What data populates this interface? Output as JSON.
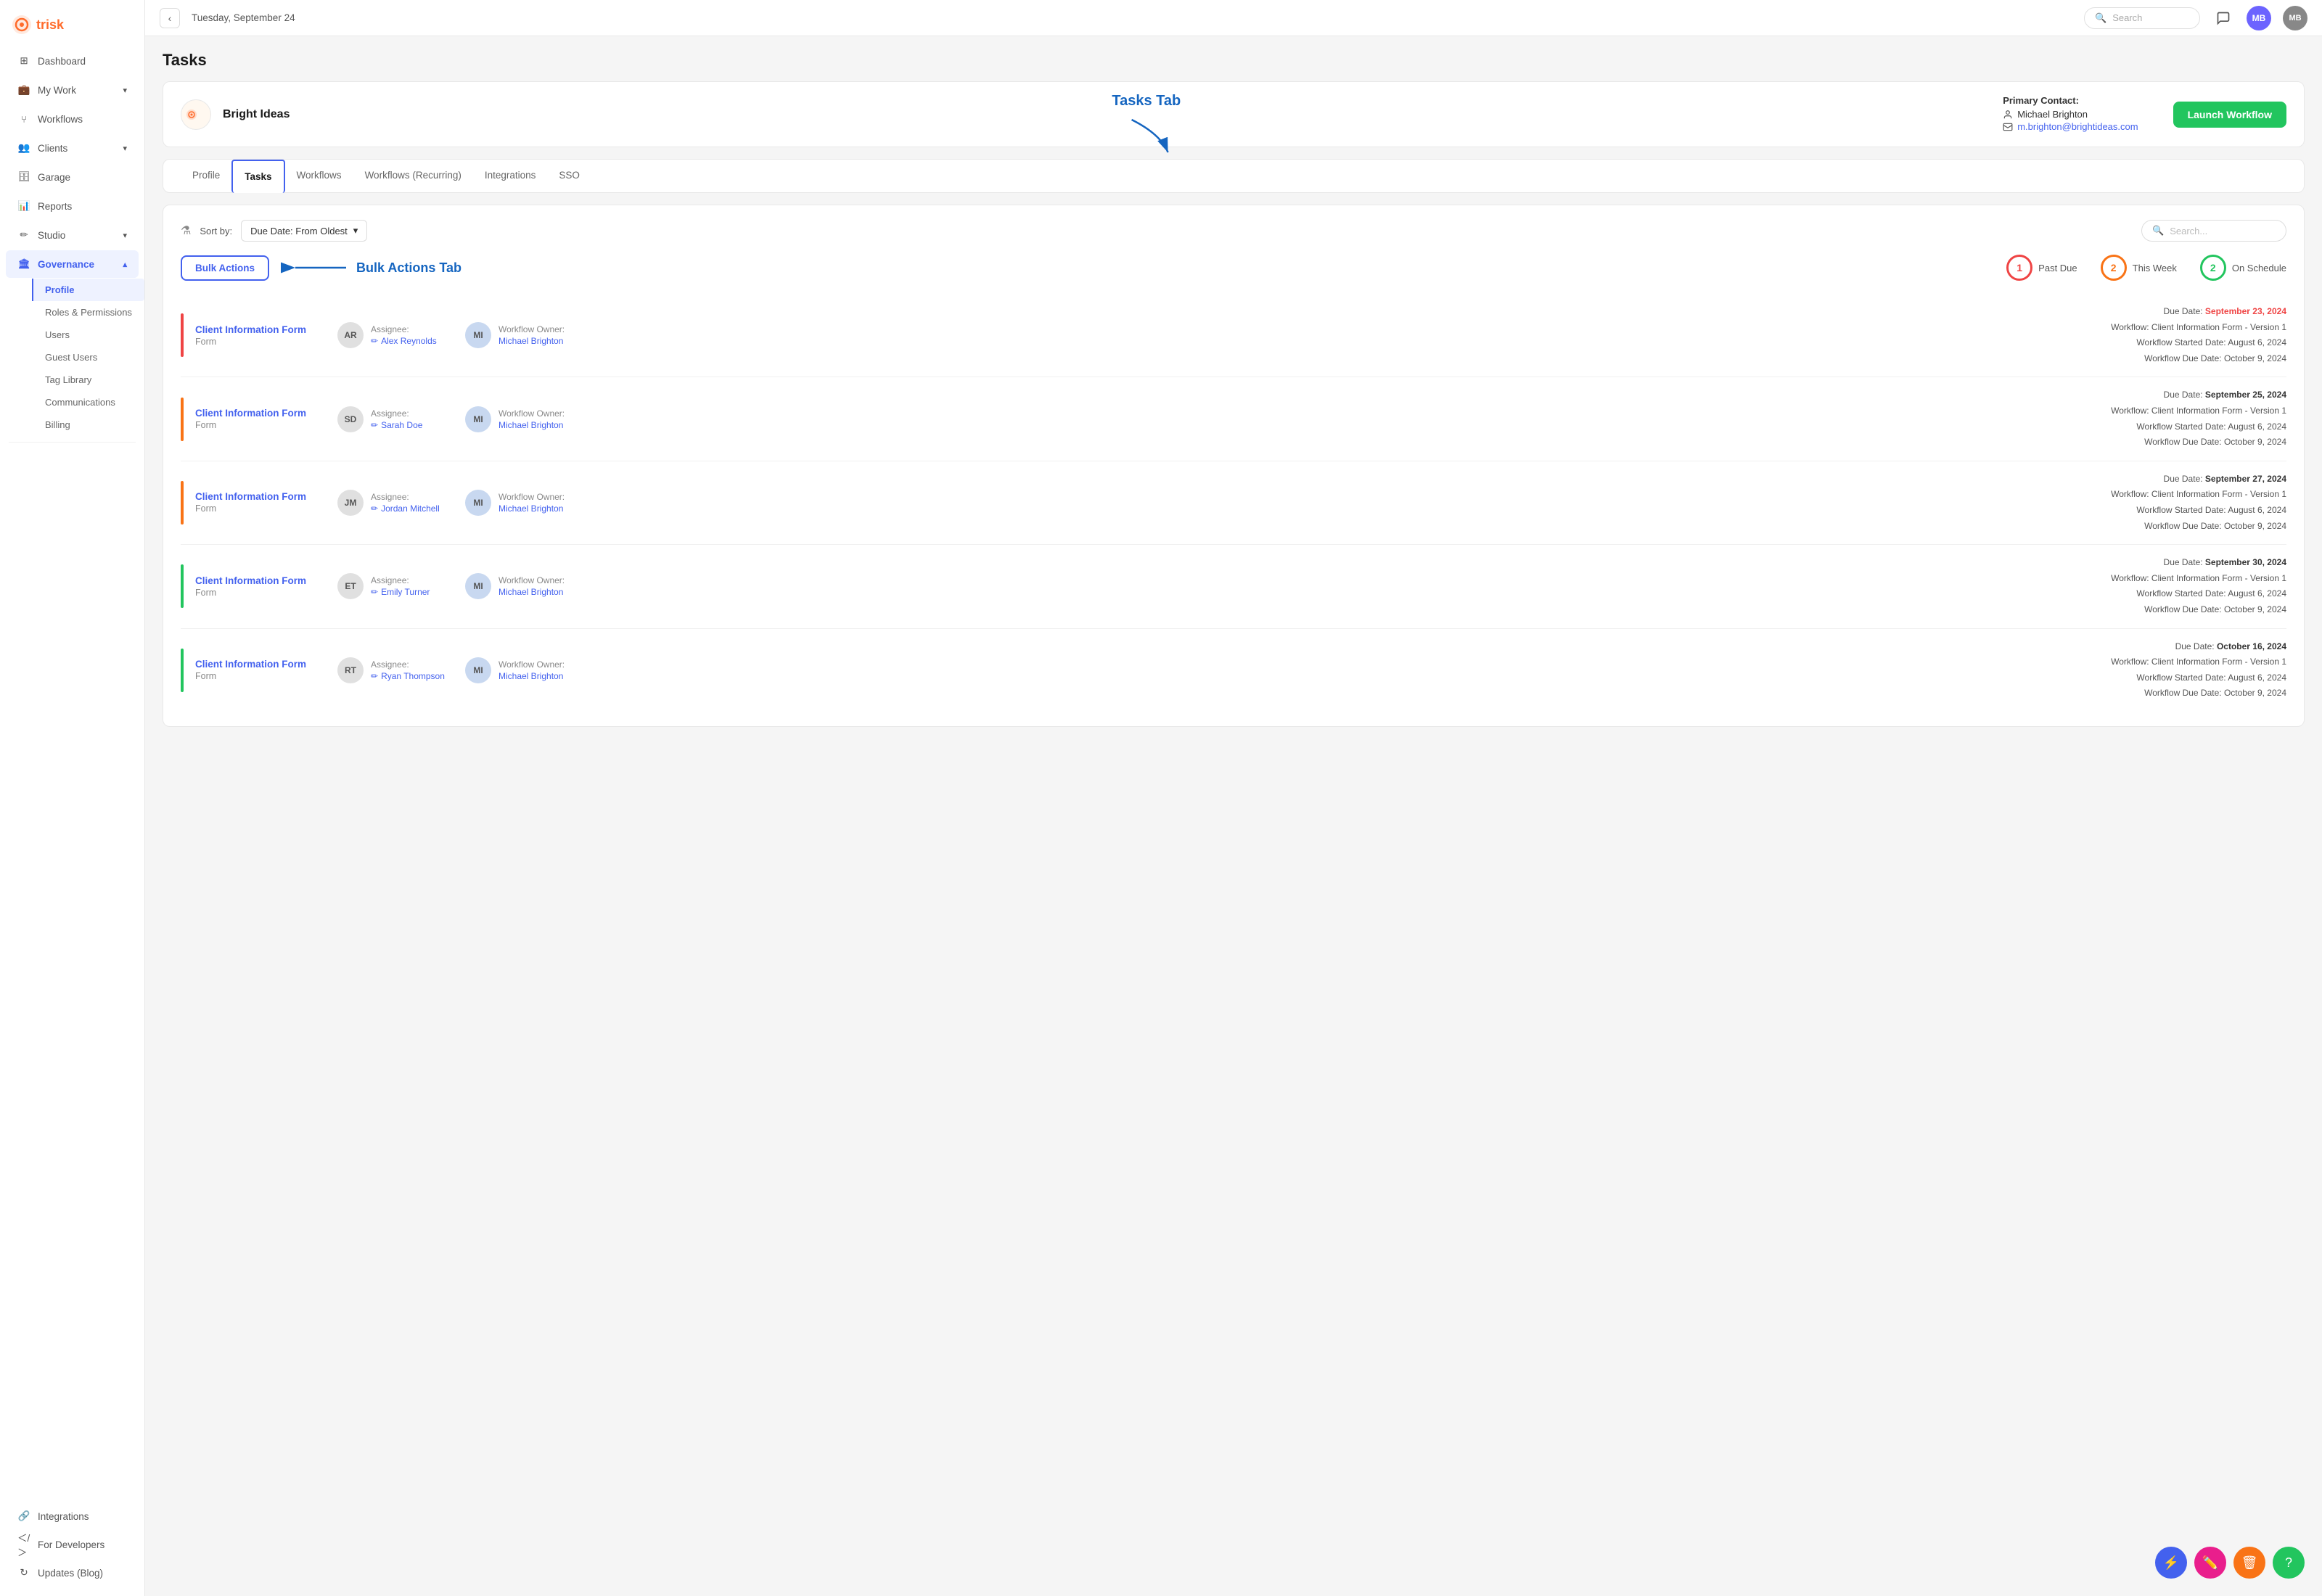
{
  "app": {
    "logo_text": "trisk",
    "header_date": "Tuesday, September 24",
    "search_placeholder": "Search",
    "user_initials": "MB"
  },
  "sidebar": {
    "items": [
      {
        "id": "dashboard",
        "label": "Dashboard",
        "icon": "grid"
      },
      {
        "id": "my-work",
        "label": "My Work",
        "icon": "briefcase",
        "has_chevron": true
      },
      {
        "id": "workflows",
        "label": "Workflows",
        "icon": "git-branch"
      },
      {
        "id": "clients",
        "label": "Clients",
        "icon": "users",
        "has_chevron": true
      },
      {
        "id": "garage",
        "label": "Garage",
        "icon": "box"
      },
      {
        "id": "reports",
        "label": "Reports",
        "icon": "bar-chart"
      },
      {
        "id": "studio",
        "label": "Studio",
        "icon": "edit",
        "has_chevron": true
      },
      {
        "id": "governance",
        "label": "Governance",
        "icon": "bank",
        "active": true,
        "has_chevron": true,
        "expanded": true
      }
    ],
    "governance_sub": [
      {
        "id": "profile",
        "label": "Profile",
        "active": true
      },
      {
        "id": "roles-permissions",
        "label": "Roles & Permissions"
      },
      {
        "id": "users",
        "label": "Users"
      },
      {
        "id": "guest-users",
        "label": "Guest Users"
      },
      {
        "id": "tag-library",
        "label": "Tag Library"
      },
      {
        "id": "communications",
        "label": "Communications"
      },
      {
        "id": "billing",
        "label": "Billing"
      }
    ],
    "bottom_items": [
      {
        "id": "integrations",
        "label": "Integrations",
        "icon": "link"
      },
      {
        "id": "for-developers",
        "label": "For Developers",
        "icon": "code"
      },
      {
        "id": "updates-blog",
        "label": "Updates (Blog)",
        "icon": "refresh"
      }
    ]
  },
  "page": {
    "title": "Tasks",
    "client": {
      "name": "Bright Ideas",
      "primary_contact_label": "Primary Contact:",
      "contact_name": "Michael Brighton",
      "contact_email": "m.brighton@brightideas.com",
      "launch_btn": "Launch Workflow"
    },
    "tabs": [
      {
        "id": "profile",
        "label": "Profile"
      },
      {
        "id": "tasks",
        "label": "Tasks",
        "active": true
      },
      {
        "id": "workflows",
        "label": "Workflows"
      },
      {
        "id": "workflows-recurring",
        "label": "Workflows (Recurring)"
      },
      {
        "id": "integrations",
        "label": "Integrations"
      },
      {
        "id": "sso",
        "label": "SSO"
      }
    ],
    "sort_label": "Sort by:",
    "sort_value": "Due Date: From Oldest",
    "search_placeholder": "Search...",
    "bulk_actions_label": "Bulk Actions",
    "stats": [
      {
        "id": "past-due",
        "count": "1",
        "label": "Past Due",
        "color": "red"
      },
      {
        "id": "this-week",
        "count": "2",
        "label": "This Week",
        "color": "orange"
      },
      {
        "id": "on-schedule",
        "count": "2",
        "label": "On Schedule",
        "color": "green"
      }
    ],
    "tasks": [
      {
        "id": "task-1",
        "title": "Client Information Form",
        "type": "Form",
        "color": "red",
        "assignee_initials": "AR",
        "assignee_label": "Assignee:",
        "assignee_name": "Alex Reynolds",
        "owner_initials": "MI",
        "owner_label": "Workflow Owner:",
        "owner_name": "Michael Brighton",
        "due_date_label": "Due Date:",
        "due_date": "September 23, 2024",
        "due_date_color": "red",
        "workflow_label": "Workflow:",
        "workflow": "Client Information Form - Version 1",
        "started_label": "Workflow Started Date:",
        "started": "August 6, 2024",
        "wf_due_label": "Workflow Due Date:",
        "wf_due": "October 9, 2024"
      },
      {
        "id": "task-2",
        "title": "Client Information Form",
        "type": "Form",
        "color": "orange",
        "assignee_initials": "SD",
        "assignee_label": "Assignee:",
        "assignee_name": "Sarah Doe",
        "owner_initials": "MI",
        "owner_label": "Workflow Owner:",
        "owner_name": "Michael Brighton",
        "due_date_label": "Due Date:",
        "due_date": "September 25, 2024",
        "due_date_color": "normal",
        "workflow_label": "Workflow:",
        "workflow": "Client Information Form - Version 1",
        "started_label": "Workflow Started Date:",
        "started": "August 6, 2024",
        "wf_due_label": "Workflow Due Date:",
        "wf_due": "October 9, 2024"
      },
      {
        "id": "task-3",
        "title": "Client Information Form",
        "type": "Form",
        "color": "orange",
        "assignee_initials": "JM",
        "assignee_label": "Assignee:",
        "assignee_name": "Jordan Mitchell",
        "owner_initials": "MI",
        "owner_label": "Workflow Owner:",
        "owner_name": "Michael Brighton",
        "due_date_label": "Due Date:",
        "due_date": "September 27, 2024",
        "due_date_color": "normal",
        "workflow_label": "Workflow:",
        "workflow": "Client Information Form - Version 1",
        "started_label": "Workflow Started Date:",
        "started": "August 6, 2024",
        "wf_due_label": "Workflow Due Date:",
        "wf_due": "October 9, 2024"
      },
      {
        "id": "task-4",
        "title": "Client Information Form",
        "type": "Form",
        "color": "green",
        "assignee_initials": "ET",
        "assignee_label": "Assignee:",
        "assignee_name": "Emily Turner",
        "owner_initials": "MI",
        "owner_label": "Workflow Owner:",
        "owner_name": "Michael Brighton",
        "due_date_label": "Due Date:",
        "due_date": "September 30, 2024",
        "due_date_color": "normal",
        "workflow_label": "Workflow:",
        "workflow": "Client Information Form - Version 1",
        "started_label": "Workflow Started Date:",
        "started": "August 6, 2024",
        "wf_due_label": "Workflow Due Date:",
        "wf_due": "October 9, 2024"
      },
      {
        "id": "task-5",
        "title": "Client Information Form",
        "type": "Form",
        "color": "green",
        "assignee_initials": "RT",
        "assignee_label": "Assignee:",
        "assignee_name": "Ryan Thompson",
        "owner_initials": "MI",
        "owner_label": "Workflow Owner:",
        "owner_name": "Michael Brighton",
        "due_date_label": "Due Date:",
        "due_date": "October 16, 2024",
        "due_date_color": "normal",
        "workflow_label": "Workflow:",
        "workflow": "Client Information Form - Version 1",
        "started_label": "Workflow Started Date:",
        "started": "August 6, 2024",
        "wf_due_label": "Workflow Due Date:",
        "wf_due": "October 9, 2024"
      }
    ]
  },
  "annotations": {
    "tasks_tab_label": "Tasks Tab",
    "bulk_actions_tab_label": "Bulk Actions Tab"
  },
  "float_buttons": [
    {
      "id": "lightning",
      "color": "blue",
      "icon": "⚡"
    },
    {
      "id": "pencil",
      "color": "pink",
      "icon": "✏️"
    },
    {
      "id": "trash",
      "color": "orange",
      "icon": "🗑"
    },
    {
      "id": "help",
      "color": "green",
      "icon": "?"
    }
  ]
}
